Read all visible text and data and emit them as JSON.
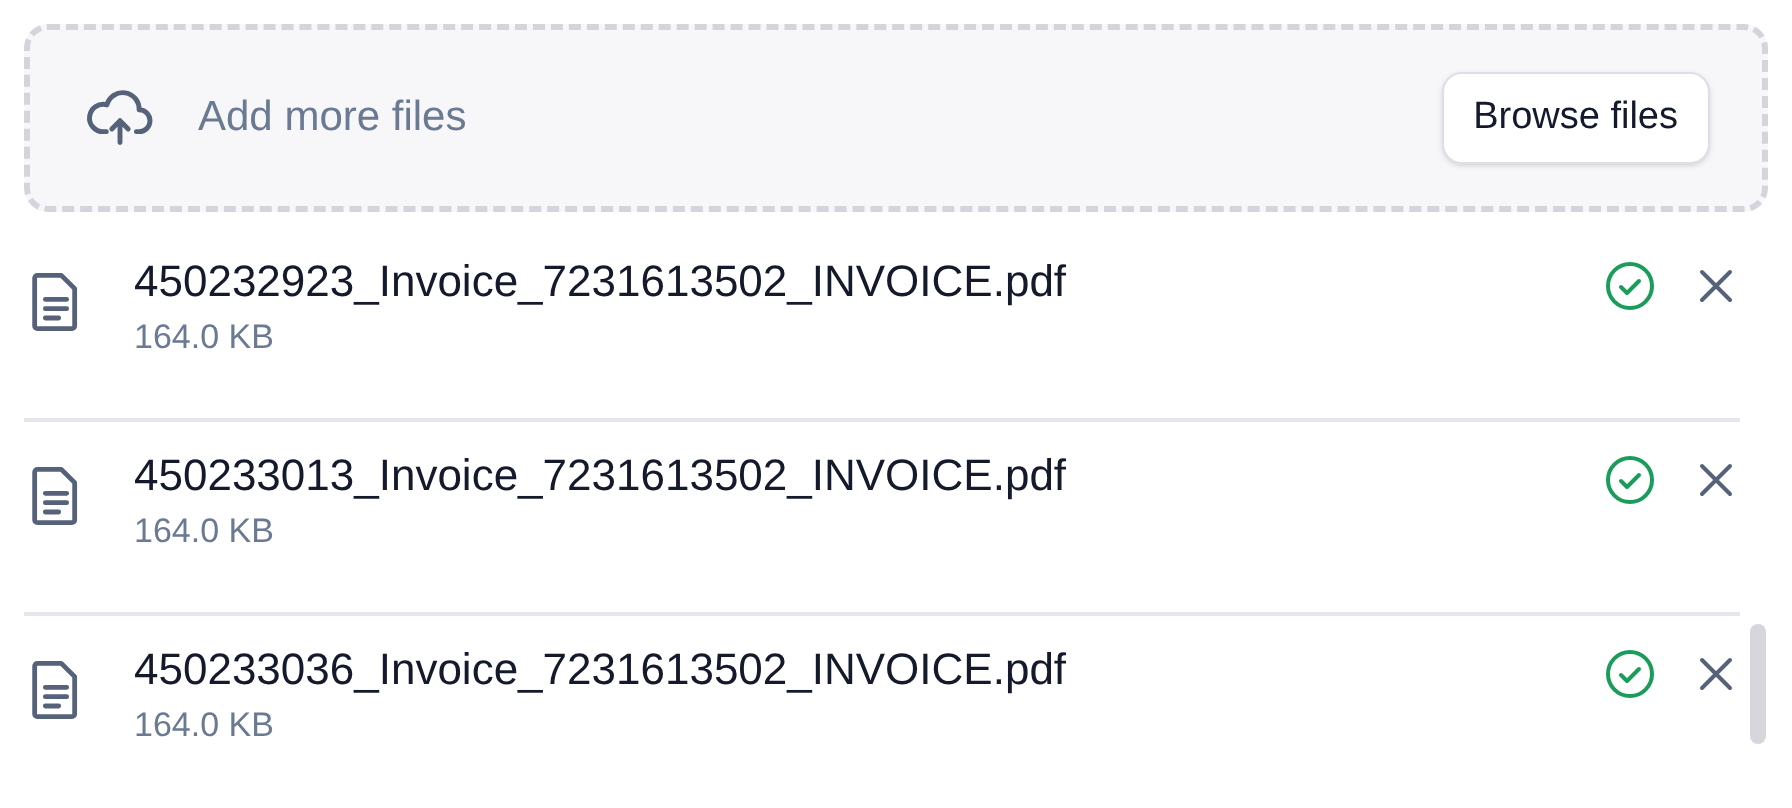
{
  "dropzone": {
    "label": "Add more files",
    "button": "Browse files"
  },
  "files": [
    {
      "name": "450232923_Invoice_7231613502_INVOICE.pdf",
      "size": "164.0 KB",
      "uploaded": true
    },
    {
      "name": "450233013_Invoice_7231613502_INVOICE.pdf",
      "size": "164.0 KB",
      "uploaded": true
    },
    {
      "name": "450233036_Invoice_7231613502_INVOICE.pdf",
      "size": "164.0 KB",
      "uploaded": true
    }
  ]
}
